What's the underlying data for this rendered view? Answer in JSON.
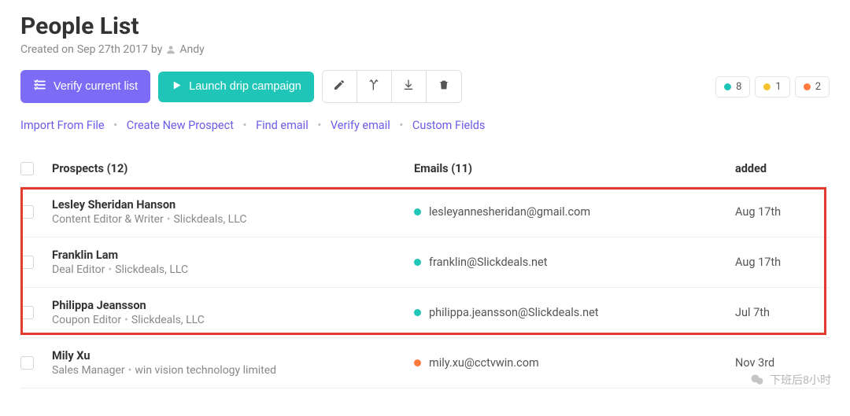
{
  "header": {
    "title": "People List",
    "created_prefix": "Created on",
    "created_date": "Sep 27th 2017",
    "created_by_word": "by",
    "author": "Andy"
  },
  "actions": {
    "verify_list": "Verify current list",
    "launch_campaign": "Launch drip campaign"
  },
  "icon_buttons": {
    "edit": "edit",
    "merge": "merge",
    "download": "download",
    "delete": "delete"
  },
  "status": {
    "green": "8",
    "yellow": "1",
    "orange": "2"
  },
  "links": {
    "import": "Import From File",
    "create": "Create New Prospect",
    "find": "Find email",
    "verify": "Verify email",
    "custom": "Custom Fields"
  },
  "table": {
    "headers": {
      "prospects": "Prospects (12)",
      "emails": "Emails (11)",
      "added": "added"
    },
    "rows": [
      {
        "name": "Lesley Sheridan Hanson",
        "position": "Content Editor & Writer",
        "company": "Slickdeals, LLC",
        "email": "lesleyannesheridan@gmail.com",
        "status_color": "#1fc6b8",
        "added": "Aug 17th"
      },
      {
        "name": "Franklin Lam",
        "position": "Deal Editor",
        "company": "Slickdeals, LLC",
        "email": "franklin@Slickdeals.net",
        "status_color": "#1fc6b8",
        "added": "Aug 17th"
      },
      {
        "name": "Philippa Jeansson",
        "position": "Coupon Editor",
        "company": "Slickdeals, LLC",
        "email": "philippa.jeansson@Slickdeals.net",
        "status_color": "#1fc6b8",
        "added": "Jul 7th"
      },
      {
        "name": "Mily Xu",
        "position": "Sales Manager",
        "company": "win vision technology limited",
        "email": "mily.xu@cctvwin.com",
        "status_color": "#ff7a3d",
        "added": "Nov 3rd"
      }
    ]
  },
  "watermark": {
    "text": "下班后8小时"
  }
}
